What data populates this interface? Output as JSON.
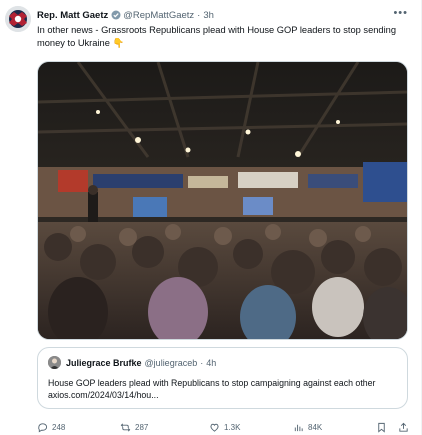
{
  "tweet": {
    "author_name": "Rep. Matt Gaetz",
    "author_handle": "@RepMattGaetz",
    "time": "3h",
    "text": "In other news - Grassroots Republicans plead with House GOP leaders to stop sending money to Ukraine 👇",
    "more_icon": "more-icon",
    "verified_color": "#829aab"
  },
  "quote": {
    "author_name": "Juliegrace Brufke",
    "author_handle": "@juliegraceb",
    "time": "4h",
    "text": "House GOP leaders plead with Republicans to stop campaigning against each other axios.com/2024/03/14/hou..."
  },
  "actions": {
    "replies": "248",
    "retweets": "287",
    "likes": "1.3K",
    "views": "84K"
  },
  "colors": {
    "text_primary": "#0f1419",
    "text_secondary": "#536471",
    "border": "#cfd9de"
  }
}
